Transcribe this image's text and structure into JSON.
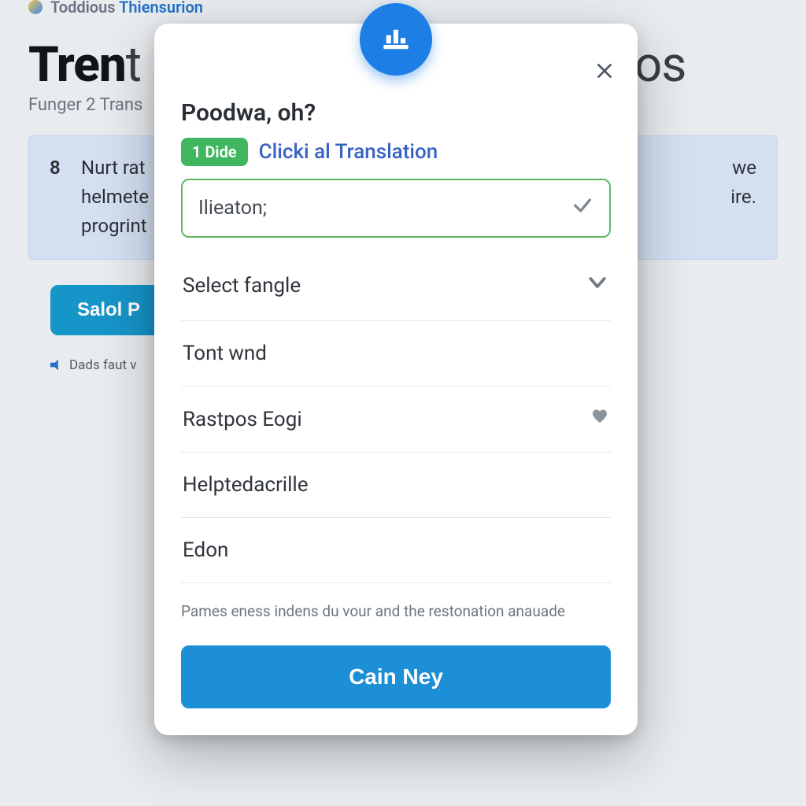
{
  "topbar": {
    "brand_left": "Toddious",
    "brand_right": "Thiensurion"
  },
  "page": {
    "title_strong": "Tren",
    "title_thin": "t",
    "title_tail": "os",
    "subtitle": "Funger 2 Trans",
    "banner_num": "8",
    "banner_text_a": "Nurt rat",
    "banner_text_b": "we",
    "banner_line2_a": "helmete",
    "banner_line2_b": "ire.",
    "banner_line3": "progrint",
    "button_label": "Salol P",
    "audio_label": "Dads faut v"
  },
  "modal": {
    "title": "Poodwa, oh?",
    "chip": "1 Dide",
    "tagline": "Clicki al Translation",
    "input_value": "Ilieaton;",
    "options": [
      {
        "label": "Select fangle",
        "icon": "chevron"
      },
      {
        "label": "Tont wnd",
        "icon": ""
      },
      {
        "label": "Rastpos Eogi",
        "icon": "heart"
      },
      {
        "label": "Helptedacrille",
        "icon": ""
      },
      {
        "label": "Edon",
        "icon": ""
      }
    ],
    "helper": "Pames eness indens du vour and the restonation anauade",
    "primary": "Cain Ney"
  }
}
